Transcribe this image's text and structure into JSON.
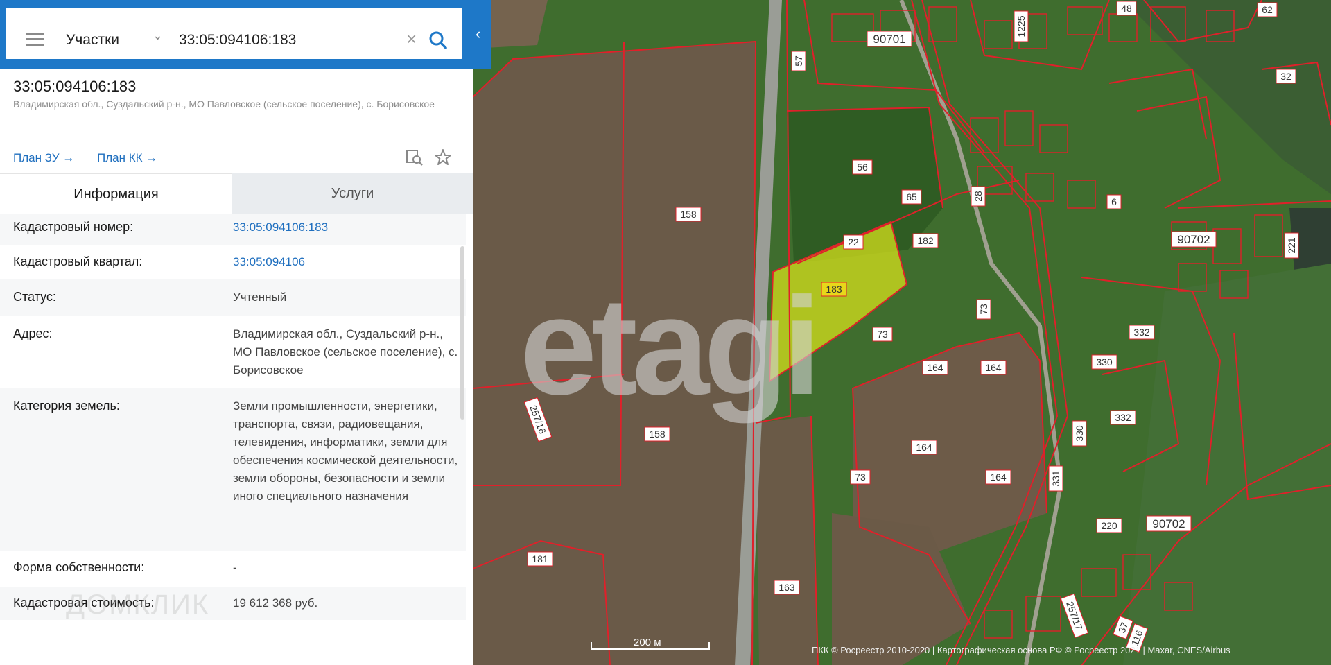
{
  "search": {
    "type": "Участки",
    "query": "33:05:094106:183"
  },
  "parcel": {
    "number": "33:05:094106:183",
    "address": "Владимирская обл., Суздальский р-н., МО Павловское (сельское поселение), с. Борисовское",
    "plan_zu": "План ЗУ →",
    "plan_kk": "План КК →"
  },
  "tabs": {
    "info": "Информация",
    "services": "Услуги"
  },
  "info": [
    {
      "label": "Кадастровый номер:",
      "value": "33:05:094106:183"
    },
    {
      "label": "Кадастровый квартал:",
      "value": "33:05:094106"
    },
    {
      "label": "Статус:",
      "value": "Учтенный"
    },
    {
      "label": "Адрес:",
      "value": "Владимирская обл., Суздальский р-н., МО Павловское (сельское поселение), с. Борисовское"
    },
    {
      "label": "Категория земель:",
      "value": "Земли промышленности, энергетики, транспорта, связи, радиовещания, телевидения, информатики, земли для обеспечения космической деятельности, земли обороны, безопасности и земли иного специального назначения"
    },
    {
      "label": "Форма собственности:",
      "value": "-"
    },
    {
      "label": "Кадастровая стоимость:",
      "value": "19 612 368 руб."
    }
  ],
  "watermarks": {
    "domclick": "ДОМКЛИК",
    "etagi": "etagi"
  },
  "map": {
    "labels": [
      "90701",
      "1225",
      "48",
      "62",
      "57",
      "32",
      "56",
      "65",
      "28",
      "6",
      "158",
      "22",
      "182",
      "90702",
      "221",
      "183",
      "73",
      "332",
      "73",
      "164",
      "164",
      "330",
      "257/16",
      "158",
      "332",
      "330",
      "164",
      "73",
      "164",
      "331",
      "181",
      "220",
      "90702",
      "163",
      "257/17",
      "37",
      "116"
    ],
    "scale": "200 м",
    "attribution": "ПКК © Росреестр 2010-2020 | Картографическая основа РФ © Росреестр 2021 | Maxar, CNES/Airbus"
  },
  "colors": {
    "accent": "#1e78c8",
    "boundary": "#e0202a",
    "highlight": "#d8e21a"
  }
}
